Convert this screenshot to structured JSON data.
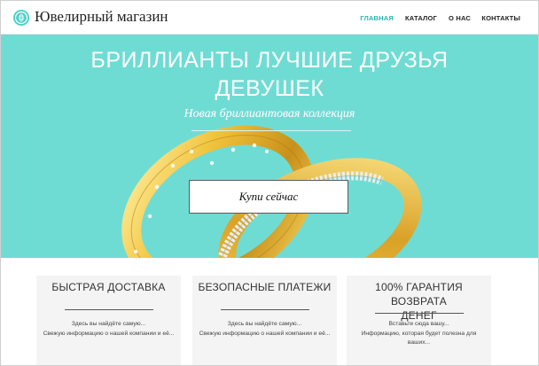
{
  "header": {
    "logo_text": "Ювелирный магазин",
    "logo_icon": "diamond-icon",
    "nav": [
      {
        "label": "ГЛАВНАЯ",
        "active": true
      },
      {
        "label": "КАТАЛОГ",
        "active": false
      },
      {
        "label": "О НАС",
        "active": false
      },
      {
        "label": "КОНТАКТЫ",
        "active": false
      }
    ]
  },
  "hero": {
    "title_line1": "БРИЛЛИАНТЫ ЛУЧШИЕ ДРУЗЬЯ",
    "title_line2": "ДЕВУШЕК",
    "subtitle": "Новая бриллиантовая коллекция",
    "button_label": "Купи сейчас"
  },
  "features": [
    {
      "title": "БЫСТРАЯ ДОСТАВКА",
      "text_line1": "Здесь вы найдёте самую...",
      "text_line2": "Свежую информацию о нашей компании и её..."
    },
    {
      "title": "БЕЗОПАСНЫЕ ПЛАТЕЖИ",
      "text_line1": "Здесь вы найдёте самую...",
      "text_line2": "Свежую информацию о нашей компании и её..."
    },
    {
      "title_line1": "100% ГАРАНТИЯ ВОЗВРАТА",
      "title_line2": "ДЕНЕГ",
      "text_line1": "Вставьте сюда вашу...",
      "text_line2": "Информацию, которая будет полезна для",
      "text_line3": "ваших..."
    }
  ],
  "colors": {
    "accent": "#2ab3b3",
    "hero_background": "#6fdcd4",
    "gold": "#e0b12a"
  }
}
